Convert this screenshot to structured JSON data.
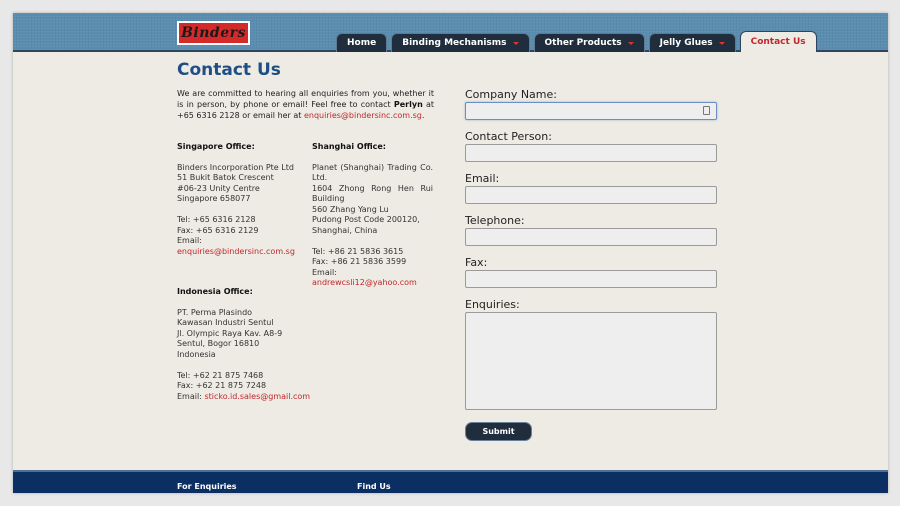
{
  "brand": {
    "logo_text": "Binders"
  },
  "nav": {
    "home": "Home",
    "binding": "Binding Mechanisms",
    "other": "Other Products",
    "jelly": "Jelly Glues",
    "contact": "Contact Us"
  },
  "page": {
    "title": "Contact Us",
    "intro_1": "We are committed to hearing all enquiries from you, whether it is in person, by phone or email! Feel free to contact ",
    "intro_name": "Perlyn",
    "intro_2": " at +65 6316 2128 or email her at ",
    "intro_email": "enquiries@bindersinc.com.sg",
    "intro_3": "."
  },
  "offices": {
    "singapore": {
      "heading": "Singapore Office:",
      "l1": "Binders Incorporation Pte Ltd",
      "l2": "51 Bukit Batok Crescent",
      "l3": "#06-23 Unity Centre",
      "l4": "Singapore 658077",
      "tel": "Tel: +65 6316 2128",
      "fax": "Fax: +65 6316 2129",
      "email_label": "Email:",
      "email": "enquiries@bindersinc.com.sg"
    },
    "shanghai": {
      "heading": "Shanghai Office:",
      "l1": "Planet (Shanghai) Trading Co. Ltd.",
      "l2": "1604 Zhong Rong Hen Rui Building",
      "l3": "560 Zhang Yang Lu",
      "l4": "Pudong Post Code 200120,",
      "l5": "Shanghai, China",
      "tel": "Tel: +86 21 5836 3615",
      "fax": "Fax: +86 21 5836 3599",
      "email_label": "Email: ",
      "email": "andrewcsli12@yahoo.com"
    },
    "indonesia": {
      "heading": "Indonesia Office:",
      "l1": "PT. Perma Plasindo",
      "l2": "Kawasan Industri Sentul",
      "l3": "Jl. Olympic Raya Kav. A8-9",
      "l4": "Sentul, Bogor 16810",
      "l5": "Indonesia",
      "tel": "Tel: +62 21 875 7468",
      "fax": "Fax: +62 21 875 7248",
      "email_label": "Email: ",
      "email": "sticko.id.sales@gmail.com"
    }
  },
  "form": {
    "company_label": "Company Name:",
    "contact_label": "Contact Person:",
    "email_label": "Email:",
    "telephone_label": "Telephone:",
    "fax_label": "Fax:",
    "enquiries_label": "Enquiries:",
    "submit": "Submit"
  },
  "footer": {
    "enquiries": "For Enquiries",
    "find_us": "Find Us"
  },
  "colors": {
    "header_blue": "#5b8db0",
    "nav_dark": "#1f2d3d",
    "title_blue": "#1f4e86",
    "link_red": "#c0272d",
    "footer_navy": "#0b2e63"
  }
}
